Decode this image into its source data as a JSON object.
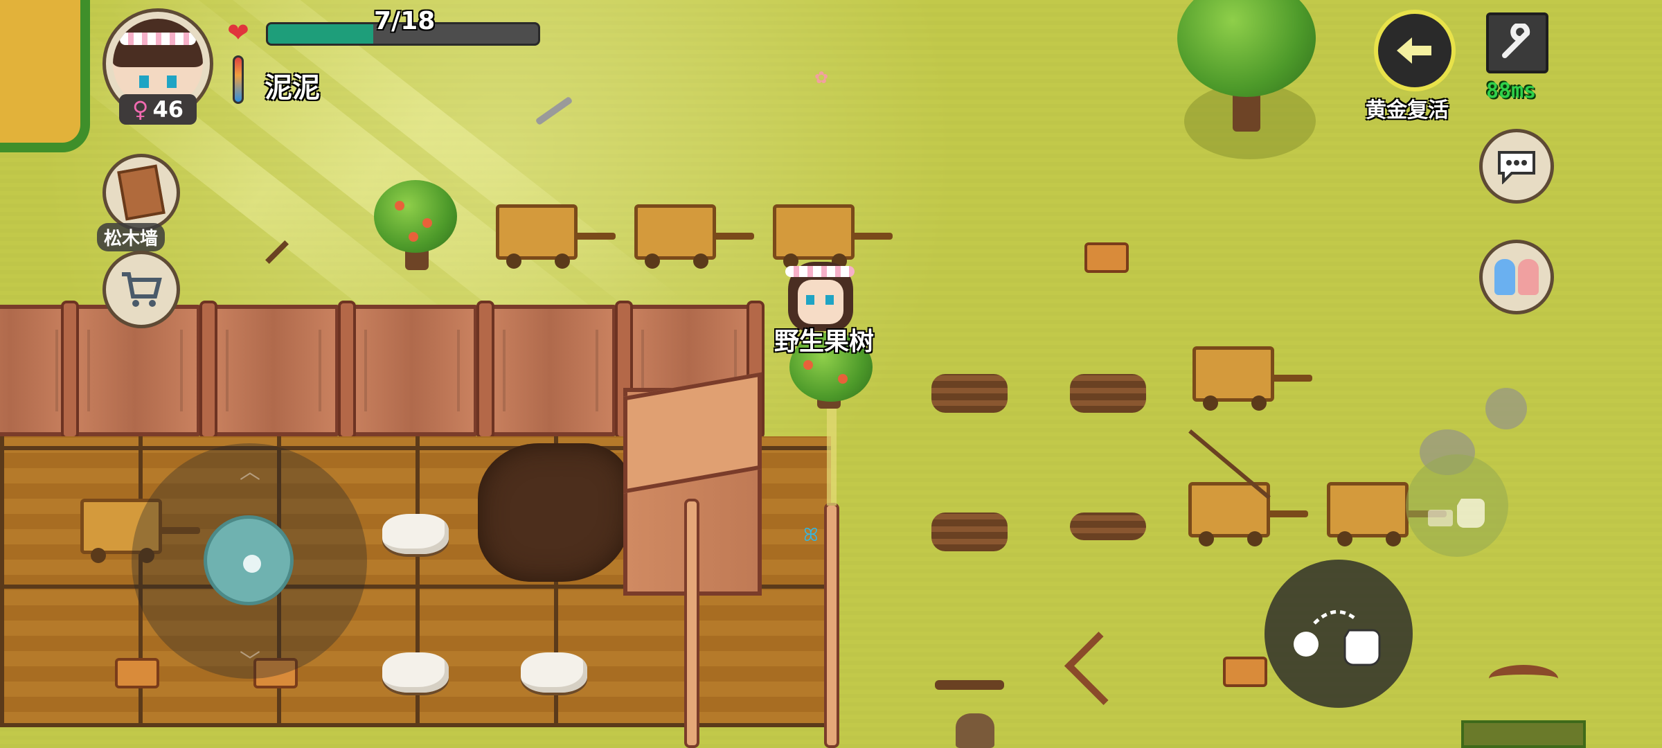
{
  "player": {
    "name": "泥泥",
    "level": "46",
    "gender_symbol": "♀",
    "hp_text": "7/18",
    "hp_fraction": 0.39
  },
  "sidebar": {
    "build_label": "松木墙"
  },
  "top_right": {
    "revive_label": "黄金复活",
    "ping": "88ms"
  },
  "world": {
    "tree_label": "野生果树"
  },
  "icons": {
    "heart": "heart-icon",
    "thermometer": "thermometer-icon",
    "back": "arrow-left-icon",
    "settings": "wrench-icon",
    "chat": "chat-bubble-icon",
    "social": "friends-icon",
    "cart": "shopping-cart-icon"
  },
  "colors": {
    "hp_fill": "#1e9e7a",
    "ping": "#2fd04a",
    "grass": "#c2c94a"
  }
}
